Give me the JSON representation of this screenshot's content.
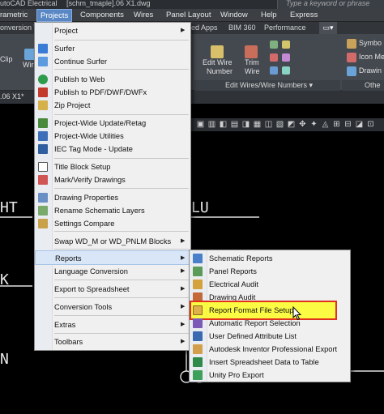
{
  "titlebar": {
    "app_text": "utoCAD Electrical",
    "file_text": "[schm_tmaple].06 X1.dwg",
    "search_placeholder": "Type a keyword or phrase"
  },
  "menubar": {
    "items": [
      "rametric",
      "Projects",
      "Components",
      "Wires",
      "Panel Layout",
      "Window",
      "Help",
      "Express"
    ]
  },
  "ribbon_tabs": {
    "items": [
      "onversion To",
      "ed Apps",
      "BIM 360",
      "Performance"
    ]
  },
  "ribbon": {
    "clip_label": "Clip",
    "wire_label": "Wir",
    "edit_wire_number_label_1": "Edit Wire",
    "edit_wire_number_label_2": "Number",
    "trim_wire_label_1": "Trim",
    "trim_wire_label_2": "Wire",
    "group_label": "Edit Wires/Wire Numbers",
    "symbol_label": "Symbo",
    "icon_menu_label": "Icon Me",
    "drawing_label": "Drawin",
    "other_label": "Othe"
  },
  "doctabs": {
    "current": ".06 X1*"
  },
  "canvas": {
    "text_ht": "HT",
    "text_k": "K",
    "text_lu": "LU",
    "text_n": "N"
  },
  "projects_menu": {
    "items": [
      {
        "label": "Project",
        "submenu": true,
        "icon": "none"
      },
      {
        "label": "Surfer",
        "icon": "surfer-icon"
      },
      {
        "label": "Continue Surfer",
        "icon": "surfer-continue-icon"
      },
      {
        "label": "Publish to Web",
        "icon": "publish-web-icon"
      },
      {
        "label": "Publish to PDF/DWF/DWFx",
        "icon": "publish-pdf-icon"
      },
      {
        "label": "Zip Project",
        "icon": "zip-icon"
      },
      {
        "label": "Project-Wide Update/Retag",
        "icon": "update-icon"
      },
      {
        "label": "Project-Wide Utilities",
        "icon": "utilities-icon"
      },
      {
        "label": "IEC Tag Mode - Update",
        "icon": "iec-icon"
      },
      {
        "label": "Title Block Setup",
        "icon": "titleblock-icon"
      },
      {
        "label": "Mark/Verify Drawings",
        "icon": "mark-verify-icon"
      },
      {
        "label": "Drawing Properties",
        "icon": "drawing-properties-icon"
      },
      {
        "label": "Rename Schematic Layers",
        "icon": "rename-layers-icon"
      },
      {
        "label": "Settings Compare",
        "icon": "settings-compare-icon"
      },
      {
        "label": "Swap WD_M or WD_PNLM Blocks",
        "submenu": true,
        "icon": "none"
      },
      {
        "label": "Reports",
        "submenu": true,
        "icon": "none"
      },
      {
        "label": "Language Conversion",
        "submenu": true,
        "icon": "none"
      },
      {
        "label": "Export to Spreadsheet",
        "submenu": true,
        "icon": "none"
      },
      {
        "label": "Conversion Tools",
        "submenu": true,
        "icon": "none"
      },
      {
        "label": "Extras",
        "submenu": true,
        "icon": "none"
      },
      {
        "label": "Toolbars",
        "submenu": true,
        "icon": "none"
      }
    ]
  },
  "reports_menu": {
    "items": [
      {
        "label": "Schematic Reports",
        "icon": "schematic-reports-icon"
      },
      {
        "label": "Panel Reports",
        "icon": "panel-reports-icon"
      },
      {
        "label": "Electrical Audit",
        "icon": "electrical-audit-icon"
      },
      {
        "label": "Drawing Audit",
        "icon": "drawing-audit-icon"
      },
      {
        "label": "Report Format File Setup",
        "icon": "report-format-icon"
      },
      {
        "label": "Automatic Report Selection",
        "icon": "auto-report-icon"
      },
      {
        "label": "User Defined Attribute List",
        "icon": "attribute-list-icon"
      },
      {
        "label": "Autodesk Inventor Professional Export",
        "icon": "inventor-export-icon"
      },
      {
        "label": "Insert Spreadsheet Data to Table",
        "icon": "spreadsheet-table-icon"
      },
      {
        "label": "Unity Pro Export",
        "icon": "unity-export-icon"
      }
    ]
  },
  "colors": {
    "menu_bg": "#f0f0f0",
    "highlight_fill": "#ffff00",
    "highlight_border": "#e0301e",
    "active_menu": "#5a88c4"
  }
}
